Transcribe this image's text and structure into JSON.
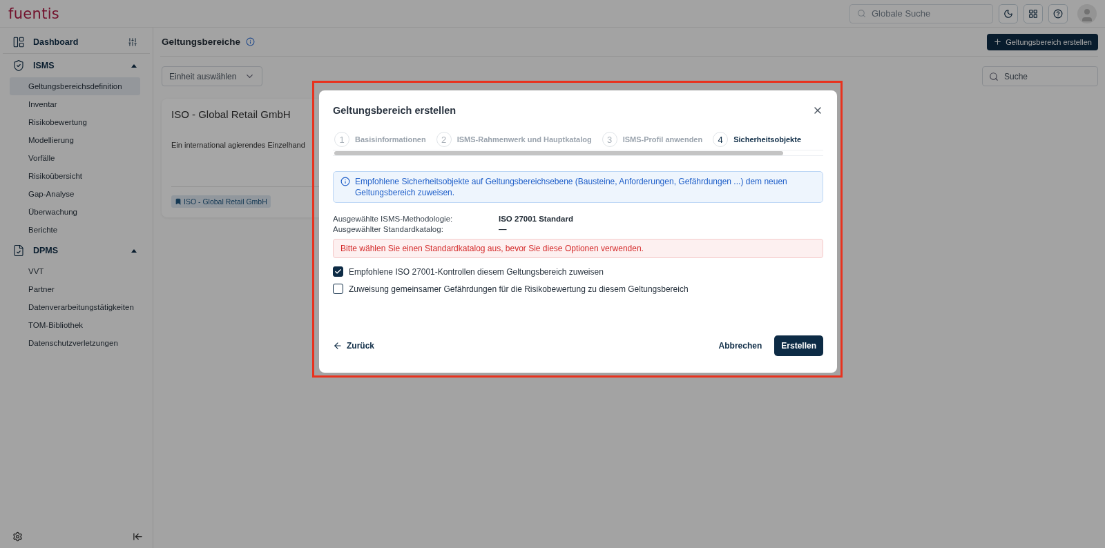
{
  "brand": "fuentis",
  "topbar": {
    "search_placeholder": "Globale Suche"
  },
  "sidebar": {
    "sections": [
      {
        "kind": "link",
        "label": "Dashboard"
      },
      {
        "kind": "group",
        "label": "ISMS",
        "expanded": true,
        "items": [
          {
            "label": "Geltungsbereichsdefinition",
            "selected": true
          },
          {
            "label": "Inventar",
            "selected": false
          },
          {
            "label": "Risikobewertung",
            "selected": false
          },
          {
            "label": "Modellierung",
            "selected": false
          },
          {
            "label": "Vorfälle",
            "selected": false
          },
          {
            "label": "Risikoübersicht",
            "selected": false
          },
          {
            "label": "Gap-Analyse",
            "selected": false
          },
          {
            "label": "Überwachung",
            "selected": false
          },
          {
            "label": "Berichte",
            "selected": false
          }
        ]
      },
      {
        "kind": "group",
        "label": "DPMS",
        "expanded": true,
        "items": [
          {
            "label": "VVT",
            "selected": false
          },
          {
            "label": "Partner",
            "selected": false
          },
          {
            "label": "Datenverarbeitungstätigkeiten",
            "selected": false
          },
          {
            "label": "TOM-Bibliothek",
            "selected": false
          },
          {
            "label": "Datenschutzverletzungen",
            "selected": false
          }
        ]
      }
    ]
  },
  "page": {
    "title": "Geltungsbereiche",
    "create_button": "Geltungsbereich erstellen",
    "unit_select": "Einheit auswählen",
    "search_placeholder": "Suche",
    "card": {
      "title": "ISO - Global Retail GmbH",
      "description": "Ein international agierendes Einzelhand",
      "tag": "ISO - Global Retail GmbH"
    }
  },
  "dialog": {
    "title": "Geltungsbereich erstellen",
    "steps": [
      {
        "number": "1",
        "label": "Basisinformationen",
        "selected": false
      },
      {
        "number": "2",
        "label": "ISMS-Rahmenwerk und Hauptkatalog",
        "selected": false
      },
      {
        "number": "3",
        "label": "ISMS-Profil anwenden",
        "selected": false
      },
      {
        "number": "4",
        "label": "Sicherheitsobjekte",
        "selected": true
      }
    ],
    "info": "Empfohlene Sicherheitsobjekte auf Geltungsbereichsebene (Bausteine, Anforderungen, Gefährdungen ...) dem neuen Geltungsbereich zuweisen.",
    "fields": [
      {
        "label": "Ausgewählte ISMS-Methodologie:",
        "value": "ISO 27001 Standard"
      },
      {
        "label": "Ausgewählter Standardkatalog:",
        "value": "—"
      }
    ],
    "warning": "Bitte wählen Sie einen Standardkatalog aus, bevor Sie diese Optionen verwenden.",
    "options": [
      {
        "label": "Empfohlene ISO 27001-Kontrollen diesem Geltungsbereich zuweisen",
        "checked": true
      },
      {
        "label": "Zuweisung gemeinsamer Gefährdungen für die Risikobewertung zu diesem Geltungsbereich",
        "checked": false
      }
    ],
    "back_button": "Zurück",
    "cancel_button": "Abbrechen",
    "submit_button": "Erstellen"
  }
}
